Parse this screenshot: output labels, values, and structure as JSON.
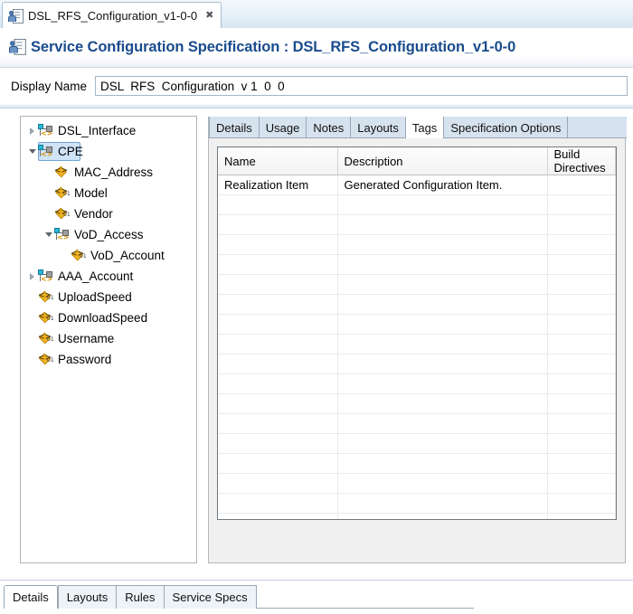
{
  "editor_tab": {
    "icon": "service-config-spec-icon",
    "label": "DSL_RFS_Configuration_v1-0-0",
    "close_glyph": "✖"
  },
  "header": {
    "icon": "service-config-spec-icon",
    "title": "Service Configuration Specification : DSL_RFS_Configuration_v1-0-0",
    "title_color": "#1a4b8c"
  },
  "display_name": {
    "label": "Display Name",
    "value": "DSL  RFS  Configuration  v 1  0  0",
    "placeholder": ""
  },
  "tree": {
    "nodes": [
      {
        "label": "DSL_Interface",
        "icon": "structure-node-icon",
        "indent": 0,
        "twisty": "closed",
        "selected": false
      },
      {
        "label": "CPE",
        "icon": "structure-node-icon",
        "indent": 0,
        "twisty": "open",
        "selected": true
      },
      {
        "label": "MAC_Address",
        "icon": "attribute-plain-icon",
        "indent": 1,
        "twisty": "none",
        "selected": false
      },
      {
        "label": "Model",
        "icon": "attribute-icon",
        "indent": 1,
        "twisty": "none",
        "selected": false
      },
      {
        "label": "Vendor",
        "icon": "attribute-icon",
        "indent": 1,
        "twisty": "none",
        "selected": false
      },
      {
        "label": "VoD_Access",
        "icon": "structure-node-icon",
        "indent": 1,
        "twisty": "open",
        "selected": false
      },
      {
        "label": "VoD_Account",
        "icon": "attribute-icon",
        "indent": 2,
        "twisty": "none",
        "selected": false
      },
      {
        "label": "AAA_Account",
        "icon": "structure-node-icon",
        "indent": 0,
        "twisty": "closed",
        "selected": false
      },
      {
        "label": "UploadSpeed",
        "icon": "attribute-icon",
        "indent": 0,
        "twisty": "none",
        "selected": false
      },
      {
        "label": "DownloadSpeed",
        "icon": "attribute-icon",
        "indent": 0,
        "twisty": "none",
        "selected": false
      },
      {
        "label": "Username",
        "icon": "attribute-icon",
        "indent": 0,
        "twisty": "none",
        "selected": false
      },
      {
        "label": "Password",
        "icon": "attribute-icon",
        "indent": 0,
        "twisty": "none",
        "selected": false
      }
    ]
  },
  "property_tabs": {
    "items": [
      {
        "label": "Details",
        "active": false
      },
      {
        "label": "Usage",
        "active": false
      },
      {
        "label": "Notes",
        "active": false
      },
      {
        "label": "Layouts",
        "active": false
      },
      {
        "label": "Tags",
        "active": true
      },
      {
        "label": "Specification Options",
        "active": false
      }
    ]
  },
  "tags_table": {
    "columns": [
      "Name",
      "Description",
      "Build Directives"
    ],
    "rows": [
      [
        "Realization Item",
        "Generated Configuration Item.",
        ""
      ],
      [
        "",
        "",
        ""
      ],
      [
        "",
        "",
        ""
      ],
      [
        "",
        "",
        ""
      ],
      [
        "",
        "",
        ""
      ],
      [
        "",
        "",
        ""
      ],
      [
        "",
        "",
        ""
      ],
      [
        "",
        "",
        ""
      ],
      [
        "",
        "",
        ""
      ],
      [
        "",
        "",
        ""
      ],
      [
        "",
        "",
        ""
      ],
      [
        "",
        "",
        ""
      ],
      [
        "",
        "",
        ""
      ],
      [
        "",
        "",
        ""
      ],
      [
        "",
        "",
        ""
      ],
      [
        "",
        "",
        ""
      ],
      [
        "",
        "",
        ""
      ],
      [
        "",
        "",
        ""
      ]
    ]
  },
  "bottom_tabs": {
    "items": [
      {
        "label": "Details",
        "active": true
      },
      {
        "label": "Layouts",
        "active": false
      },
      {
        "label": "Rules",
        "active": false
      },
      {
        "label": "Service Specs",
        "active": false
      }
    ]
  }
}
